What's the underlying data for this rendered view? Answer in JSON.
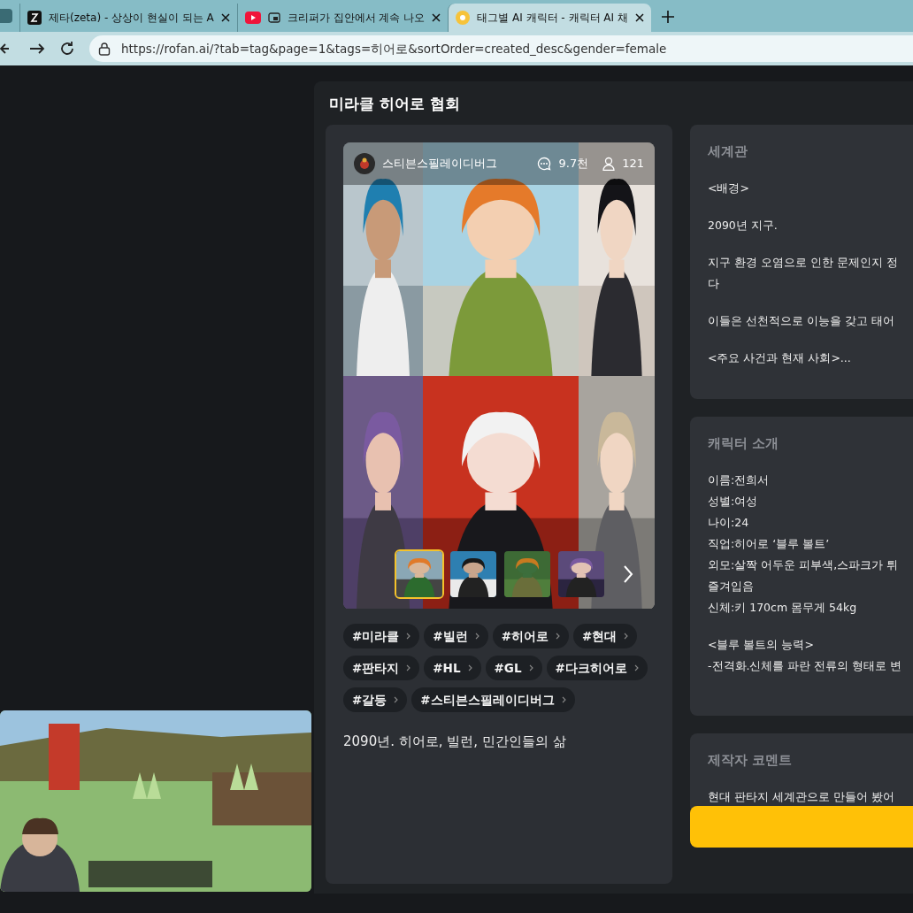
{
  "browser": {
    "tabs": [
      {
        "title": "제타(zeta) - 상상이 현실이 되는 A",
        "selected": false,
        "kind": "zeta"
      },
      {
        "title": "크리퍼가 집안에서 계속 나오",
        "selected": false,
        "kind": "youtube"
      },
      {
        "title": "태그별 AI 캐릭터 - 캐릭터 AI 채",
        "selected": true,
        "kind": "rofan"
      }
    ],
    "url": "https://rofan.ai/?tab=tag&page=1&tags=히어로&sortOrder=created_desc&gender=female"
  },
  "modal": {
    "title": "미라클 히어로 협회",
    "card": {
      "author": "스티븐스필레이디버그",
      "chats": "9.7천",
      "users": "121",
      "thumbnails": [
        {
          "selected": true
        },
        {
          "selected": false
        },
        {
          "selected": false
        },
        {
          "selected": false
        }
      ],
      "tags": [
        "#미라클",
        "#빌런",
        "#히어로",
        "#현대",
        "#판타지",
        "#HL",
        "#GL",
        "#다크히어로",
        "#갈등",
        "#스티븐스필레이디버그"
      ],
      "description": "2090년. 히어로, 빌런, 민간인들의 삶"
    },
    "panels": [
      {
        "heading": "세계관",
        "paragraphs": [
          [
            "<배경>"
          ],
          [
            "2090년 지구."
          ],
          [
            "지구 환경 오염으로 인한 문제인지 정",
            "다"
          ],
          [
            "이들은 선천적으로 이능을 갖고 태어"
          ],
          [
            "<주요 사건과 현재 사회>..."
          ]
        ]
      },
      {
        "heading": "캐릭터 소개",
        "paragraphs": [
          [
            "이름:전희서",
            "성별:여성",
            "나이:24",
            "직업:히어로 ‘블루 볼트’",
            "외모:살짝 어두운 피부색,스파크가 튀",
            "즐겨입음",
            "신체:키 170cm 몸무게 54kg"
          ],
          [
            "<블루 볼트의 능력>",
            "-전격화.신체를 파란 전류의 형태로 변"
          ]
        ]
      },
      {
        "heading": "제작자 코멘트",
        "paragraphs": [
          [
            "현대 판타지 세계관으로 만들어 봤어"
          ]
        ]
      }
    ]
  }
}
